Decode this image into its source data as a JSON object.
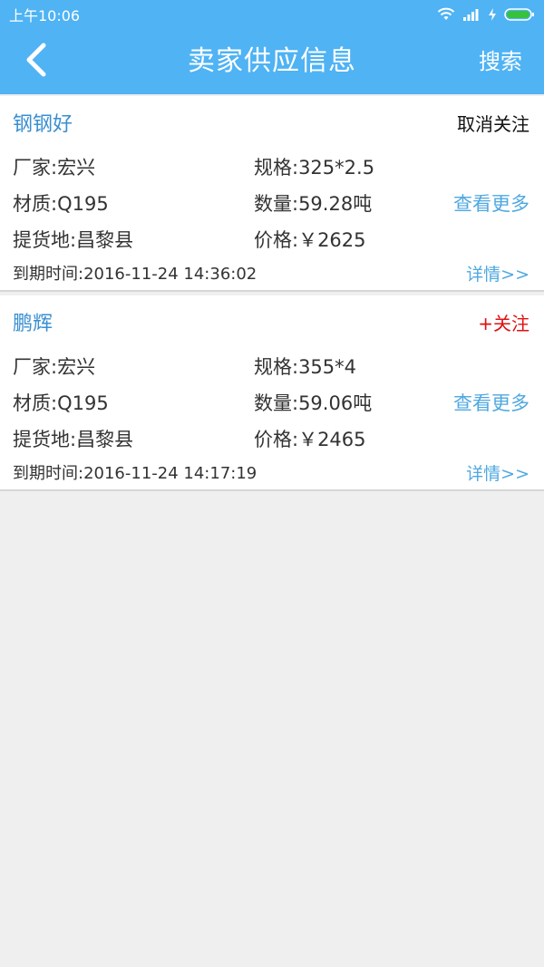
{
  "status_bar": {
    "time": "上午10:06"
  },
  "nav": {
    "title": "卖家供应信息",
    "search_label": "搜索"
  },
  "cards": [
    {
      "seller": "钢钢好",
      "follow_label": "取消关注",
      "factory": "厂家:宏兴",
      "spec": "规格:325*2.5",
      "material": "材质:Q195",
      "quantity": "数量:59.28吨",
      "more_label": "查看更多",
      "pickup": "提货地:昌黎县",
      "price": "价格:￥2625",
      "expire": "到期时间:2016-11-24 14:36:02",
      "detail_label": "详情>>"
    },
    {
      "seller": "鹏辉",
      "follow_label": "+关注",
      "factory": "厂家:宏兴",
      "spec": "规格:355*4",
      "material": "材质:Q195",
      "quantity": "数量:59.06吨",
      "more_label": "查看更多",
      "pickup": "提货地:昌黎县",
      "price": "价格:￥2465",
      "expire": "到期时间:2016-11-24 14:17:19",
      "detail_label": "详情>>"
    }
  ],
  "colors": {
    "header_bg": "#4fb3f4",
    "link": "#4fa8e0",
    "follow_red": "#e01010",
    "battery": "#36c23a"
  }
}
